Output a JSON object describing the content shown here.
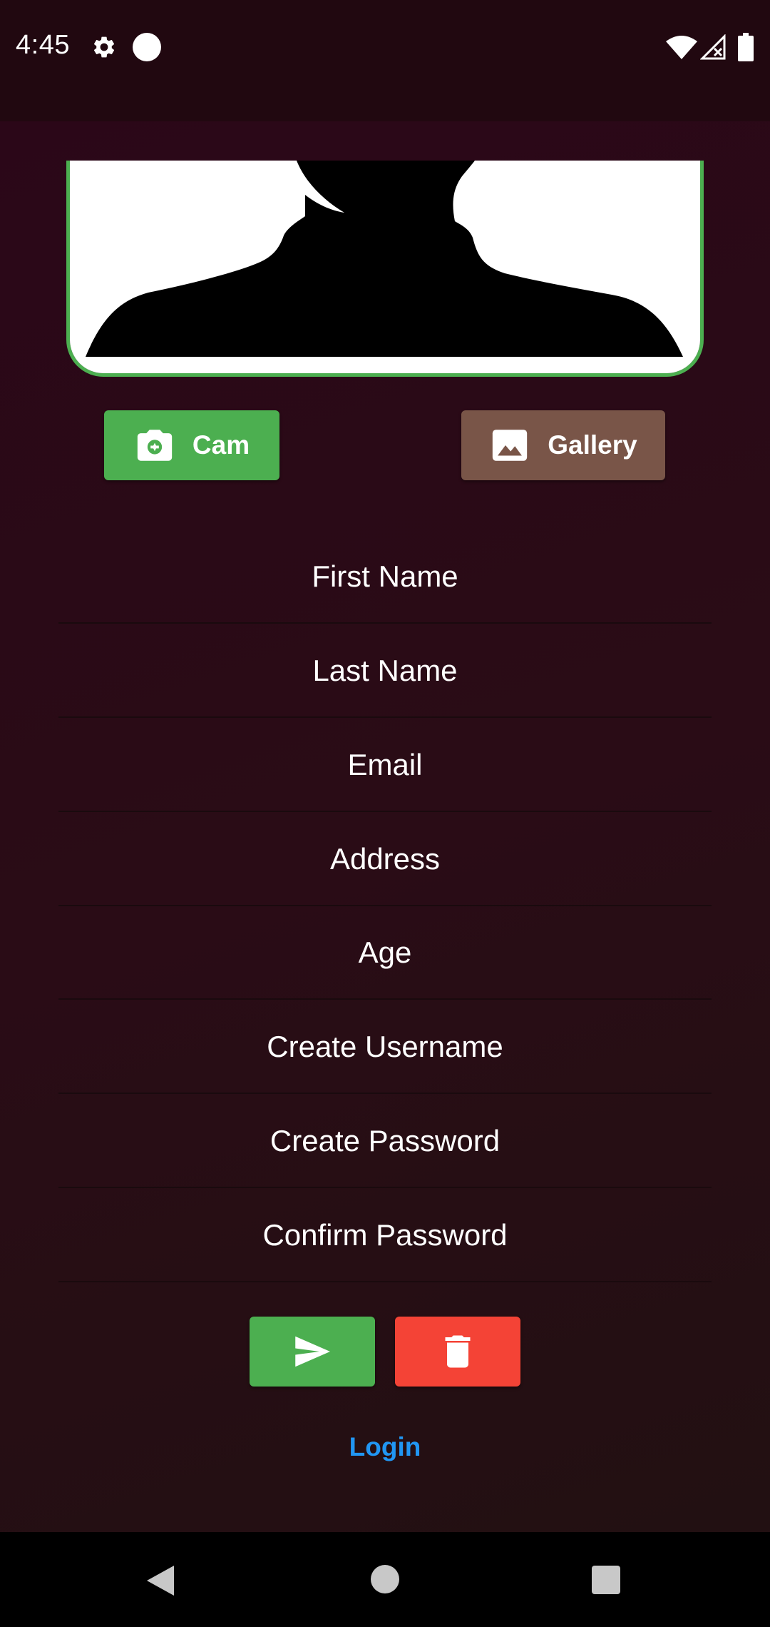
{
  "status_bar": {
    "time": "4:45",
    "icons": [
      "gear-icon",
      "circle-dot-icon",
      "wifi-icon",
      "signal-no-data-icon",
      "battery-icon"
    ]
  },
  "avatar": {
    "icon": "person-silhouette-icon",
    "border_color": "#4caf50"
  },
  "photo_buttons": {
    "cam_label": "Cam",
    "cam_icon": "camera-icon",
    "cam_color": "#4caf50",
    "gallery_label": "Gallery",
    "gallery_icon": "image-icon",
    "gallery_color": "#795548"
  },
  "form": {
    "fields": [
      {
        "placeholder": "First Name"
      },
      {
        "placeholder": "Last Name"
      },
      {
        "placeholder": "Email"
      },
      {
        "placeholder": "Address"
      },
      {
        "placeholder": "Age"
      },
      {
        "placeholder": "Create Username"
      },
      {
        "placeholder": "Create Password"
      },
      {
        "placeholder": "Confirm Password"
      }
    ]
  },
  "actions": {
    "submit_icon": "send-icon",
    "submit_color": "#4caf50",
    "delete_icon": "trash-icon",
    "delete_color": "#f44336",
    "login_label": "Login",
    "login_color": "#2196f3"
  },
  "nav_bar": {
    "icons": [
      "back-icon",
      "home-icon",
      "recents-icon"
    ]
  }
}
